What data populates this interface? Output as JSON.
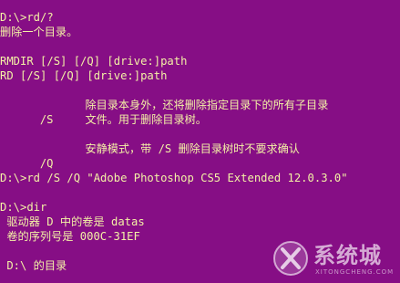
{
  "console": {
    "cmd_help": "D:\\>rd/?",
    "description": "删除一个目录。",
    "usage_rmdir": "RMDIR [/S] [/Q] [drive:]path",
    "usage_rd": "RD [/S] [/Q] [drive:]path",
    "options": [
      {
        "flag": "  /S",
        "text": [
          "除目录本身外，还将删除指定目录下的所有子目录",
          "文件。用于删除目录树。"
        ]
      },
      {
        "flag": "  /Q",
        "text": [
          "安静模式，带 /S 删除目录树时不要求确认"
        ]
      }
    ],
    "cmd_rd": "D:\\>rd /S /Q \"Adobe Photoshop CS5 Extended 12.0.3.0\"",
    "cmd_dir": "D:\\>dir",
    "volume_label": " 驱动器 D 中的卷是 datas",
    "serial_number": " 卷的序列号是 000C-31EF",
    "dir_header": " D:\\ 的目录"
  },
  "watermark": {
    "title": "系统城",
    "subtitle": "XITONGCHENG.COM"
  }
}
